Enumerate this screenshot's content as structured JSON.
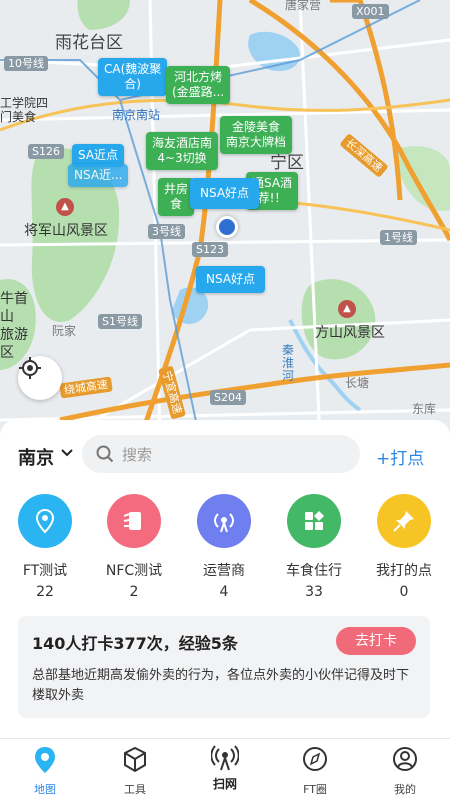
{
  "map": {
    "places": [
      {
        "key": "p1",
        "text": "雨花台区"
      },
      {
        "key": "p2",
        "text": "将军山风景区"
      },
      {
        "key": "p3",
        "text": "牛首山\n旅游区"
      },
      {
        "key": "p4",
        "text": "方山风景区"
      },
      {
        "key": "p5",
        "text": "阮家"
      },
      {
        "key": "p6",
        "text": "长塘"
      },
      {
        "key": "p7",
        "text": "东库"
      },
      {
        "key": "p8",
        "text": "秦淮河"
      },
      {
        "key": "p9",
        "text": "工学院四\n门美食"
      },
      {
        "key": "p10",
        "text": "唐家营"
      },
      {
        "key": "p11",
        "text": "宁区"
      }
    ],
    "roads": {
      "r1": "10号线",
      "r2": "S126",
      "r3": "3号线",
      "r4": "S123",
      "r5": "S1号线",
      "r6": "S204",
      "r7": "1号线",
      "r8": "X001",
      "r9": "长深高速",
      "r10": "绕城高速",
      "r11": "宁宣高速",
      "r12": "南京南站"
    },
    "pins": [
      {
        "key": "k1",
        "text": "CA(魏波聚\n合)"
      },
      {
        "key": "k2",
        "text": "河北方烤\n(金盛路..."
      },
      {
        "key": "k3",
        "text": "金陵美食\n南京大牌档"
      },
      {
        "key": "k4",
        "text": "SA近点"
      },
      {
        "key": "k5",
        "text": "海友酒店南\n4~3切换"
      },
      {
        "key": "k6",
        "text": "NSA好点"
      },
      {
        "key": "k7",
        "text": "井房\n食"
      },
      {
        "key": "k8",
        "text": "通SA酒\n荐!！"
      },
      {
        "key": "k9",
        "text": "NSA好点"
      },
      {
        "key": "k10",
        "text": "NSA近..."
      }
    ]
  },
  "sheet": {
    "city": "南京",
    "search_placeholder": "搜索",
    "add_spot": "+打点",
    "shortcuts": [
      {
        "label": "FT测试",
        "count": "22",
        "color": "#2ab4f1",
        "icon": "location-pin-icon"
      },
      {
        "label": "NFC测试",
        "count": "2",
        "color": "#f46b7f",
        "icon": "nfc-card-icon"
      },
      {
        "label": "运营商",
        "count": "4",
        "color": "#6f7ff0",
        "icon": "signal-tower-icon"
      },
      {
        "label": "车食住行",
        "count": "33",
        "color": "#43b866",
        "icon": "grid-icon"
      },
      {
        "label": "我打的点",
        "count": "0",
        "color": "#f6c525",
        "icon": "pushpin-icon"
      }
    ],
    "card": {
      "title": "140人打卡377次，经验5条",
      "button": "去打卡",
      "text": "总部基地近期高发偷外卖的行为，各位点外卖的小伙伴记得及时下楼取外卖"
    }
  },
  "tabbar": {
    "tabs": [
      {
        "label": "地图",
        "icon": "map-pin-icon",
        "active": true
      },
      {
        "label": "工具",
        "icon": "cube-icon",
        "active": false
      },
      {
        "label": "扫网",
        "icon": "antenna-icon",
        "active": false
      },
      {
        "label": "FT圈",
        "icon": "compass-icon",
        "active": false
      },
      {
        "label": "我的",
        "icon": "user-icon",
        "active": false
      }
    ]
  }
}
